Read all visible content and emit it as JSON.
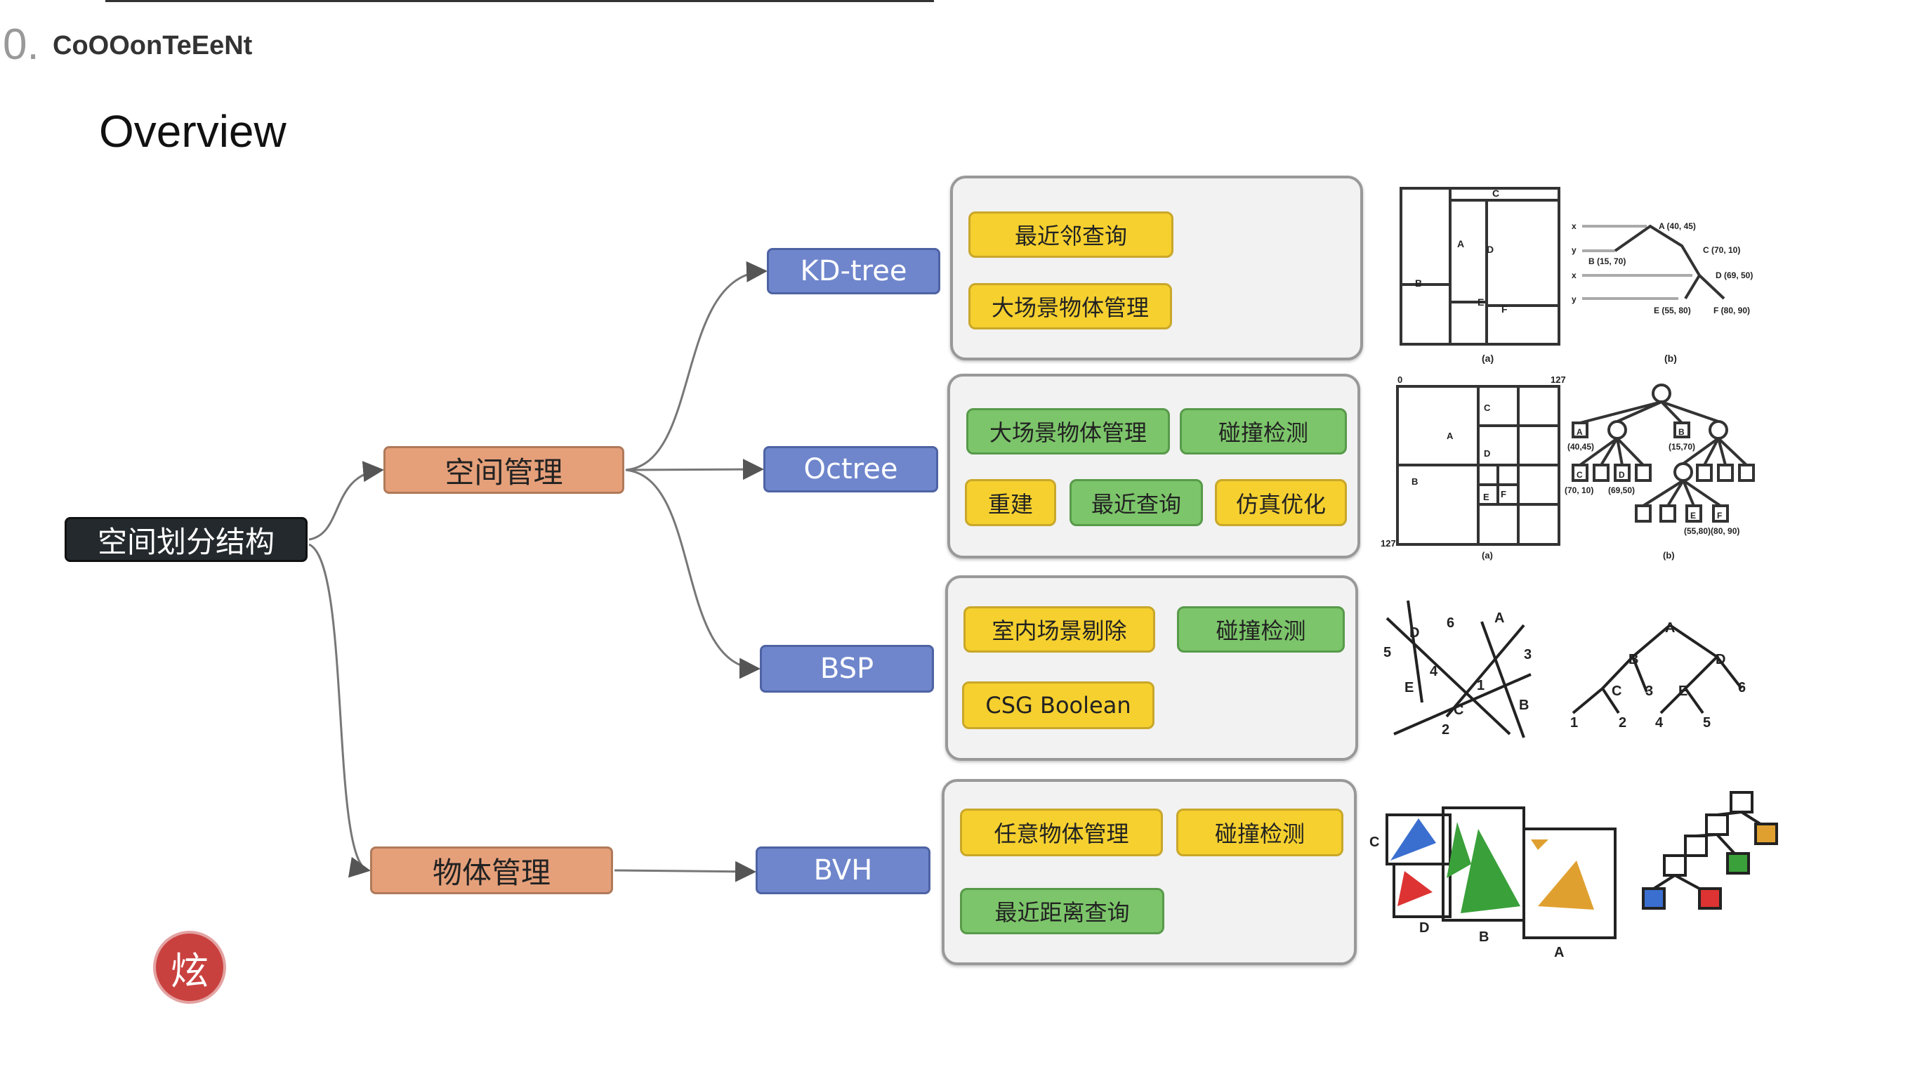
{
  "header": {
    "section_number": "0.",
    "section_title": "CoOOonTeEeNt",
    "slide_title": "Overview"
  },
  "mindmap": {
    "root": "空间划分结构",
    "spatial": "空间管理",
    "object": "物体管理",
    "structures": {
      "kd": "KD-tree",
      "octree": "Octree",
      "bsp": "BSP",
      "bvh": "BVH"
    },
    "kd_uses": [
      "最近邻查询",
      "大场景物体管理"
    ],
    "octree_uses": [
      "大场景物体管理",
      "碰撞检测",
      "重建",
      "最近查询",
      "仿真优化"
    ],
    "bsp_uses": [
      "室内场景剔除",
      "碰撞检测",
      "CSG Boolean"
    ],
    "bvh_uses": [
      "任意物体管理",
      "碰撞检测",
      "最近距离查询"
    ]
  },
  "colors": {
    "root": "#23292c",
    "manager": "#e5a07a",
    "structure": "#6f86cc",
    "yellow_tag": "#f5d02f",
    "green_tag": "#7cc56a",
    "seal": "#c9413f"
  },
  "diagrams": {
    "kd_labels": [
      "A",
      "B",
      "C",
      "D",
      "E",
      "F",
      "(a)",
      "(b)"
    ],
    "kd_tree_labels": [
      "A (40, 45)",
      "B (15, 70)",
      "C (70, 10)",
      "D (69, 50)",
      "E (55, 80)",
      "F (80, 90)",
      "x",
      "y",
      "x",
      "y"
    ],
    "octree_labels": [
      "0",
      "127",
      "127",
      "A",
      "B",
      "C",
      "D",
      "E",
      "F",
      "(a)",
      "(b)"
    ],
    "octree_tree_labels": [
      "A",
      "B",
      "C",
      "D",
      "E",
      "F",
      "(40,45)",
      "(15,70)",
      "(70, 10)",
      "(69,50)",
      "(55,80)(80, 90)"
    ],
    "bsp_labels": [
      "A",
      "B",
      "C",
      "D",
      "E",
      "1",
      "2",
      "3",
      "4",
      "5",
      "6"
    ],
    "bvh_labels": [
      "A",
      "B",
      "C",
      "D"
    ],
    "seal_glyph": "炫"
  }
}
